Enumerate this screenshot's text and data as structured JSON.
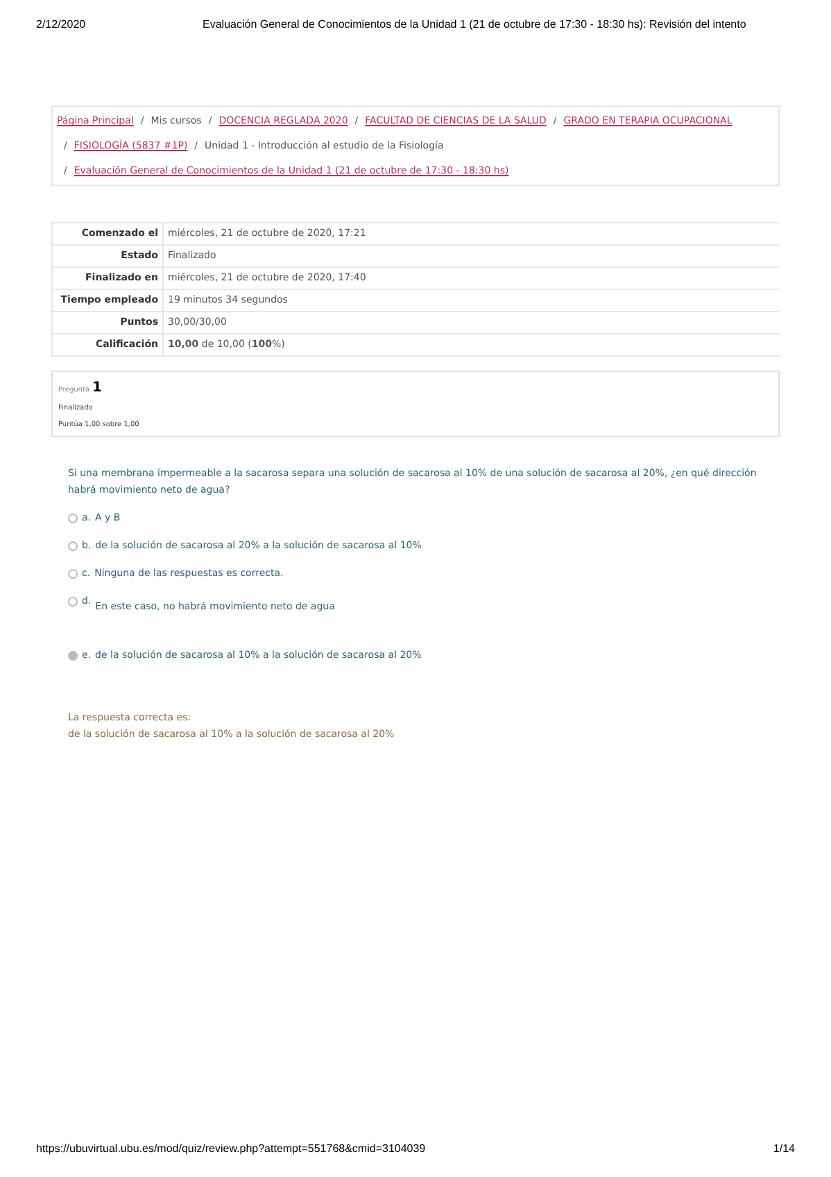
{
  "print_header": {
    "date": "2/12/2020",
    "title": "Evaluación General de Conocimientos de la Unidad 1 (21 de octubre de 17:30 - 18:30 hs): Revisión del intento"
  },
  "breadcrumb": [
    [
      {
        "label": "Página Principal",
        "link": true
      },
      {
        "separator": "/",
        "label": "Mis cursos",
        "link": false
      },
      {
        "separator": "/",
        "label": "DOCENCIA REGLADA 2020",
        "link": true
      },
      {
        "separator": "/",
        "label": "FACULTAD DE CIENCIAS DE LA SALUD",
        "link": true
      },
      {
        "separator": "/",
        "label": "GRADO EN TERAPIA OCUPACIONAL",
        "link": true
      }
    ],
    [
      {
        "separator": "/",
        "label": "FISIOLOGÍA (5837 #1P)",
        "link": true
      },
      {
        "separator": "/",
        "label": "Unidad 1 - Introducción al estudio de la Fisiología",
        "link": false
      }
    ],
    [
      {
        "separator": "/",
        "label": "Evaluación General de Conocimientos de la Unidad 1 (21 de octubre de 17:30 - 18:30 hs)",
        "link": true
      }
    ]
  ],
  "summary": [
    {
      "label": "Comenzado el",
      "value": "miércoles, 21 de octubre de 2020, 17:21"
    },
    {
      "label": "Estado",
      "value": "Finalizado"
    },
    {
      "label": "Finalizado en",
      "value": "miércoles, 21 de octubre de 2020, 17:40"
    },
    {
      "label": "Tiempo empleado",
      "value": "19 minutos 34 segundos"
    },
    {
      "label": "Puntos",
      "value": "30,00/30,00"
    },
    {
      "label": "Calificación",
      "value": "**10,00** de 10,00 (**100**%)"
    }
  ],
  "question_info": {
    "label": "Pregunta",
    "number": "1",
    "state": "Finalizado",
    "grade": "Puntúa 1,00 sobre 1,00"
  },
  "question": {
    "text": "Si una membrana impermeable a la sacarosa separa una solución de sacarosa al 10% de una solución de sacarosa al 20%, ¿en qué dirección habrá movimiento neto de agua?",
    "options": [
      {
        "letter": "a.",
        "text": "A y B",
        "selected": false
      },
      {
        "letter": "b.",
        "text": "de la solución de sacarosa al 20% a la solución de sacarosa al  10%",
        "selected": false
      },
      {
        "letter": "c.",
        "text": "Ninguna de las respuestas es correcta.",
        "selected": false
      },
      {
        "letter": "d.",
        "text": "En este caso, no habrá movimiento neto de agua",
        "selected": false
      },
      {
        "letter": "e.",
        "text": "de la solución de sacarosa al 10% a la solución de sacarosa al 20%",
        "selected": true
      }
    ]
  },
  "feedback": {
    "heading": "La respuesta correcta es:",
    "answer": "de la solución de sacarosa al 10% a la solución de sacarosa al 20%"
  },
  "print_footer": {
    "url": "https://ubuvirtual.ubu.es/mod/quiz/review.php?attempt=551768&cmid=3104039",
    "page": "1/14"
  }
}
